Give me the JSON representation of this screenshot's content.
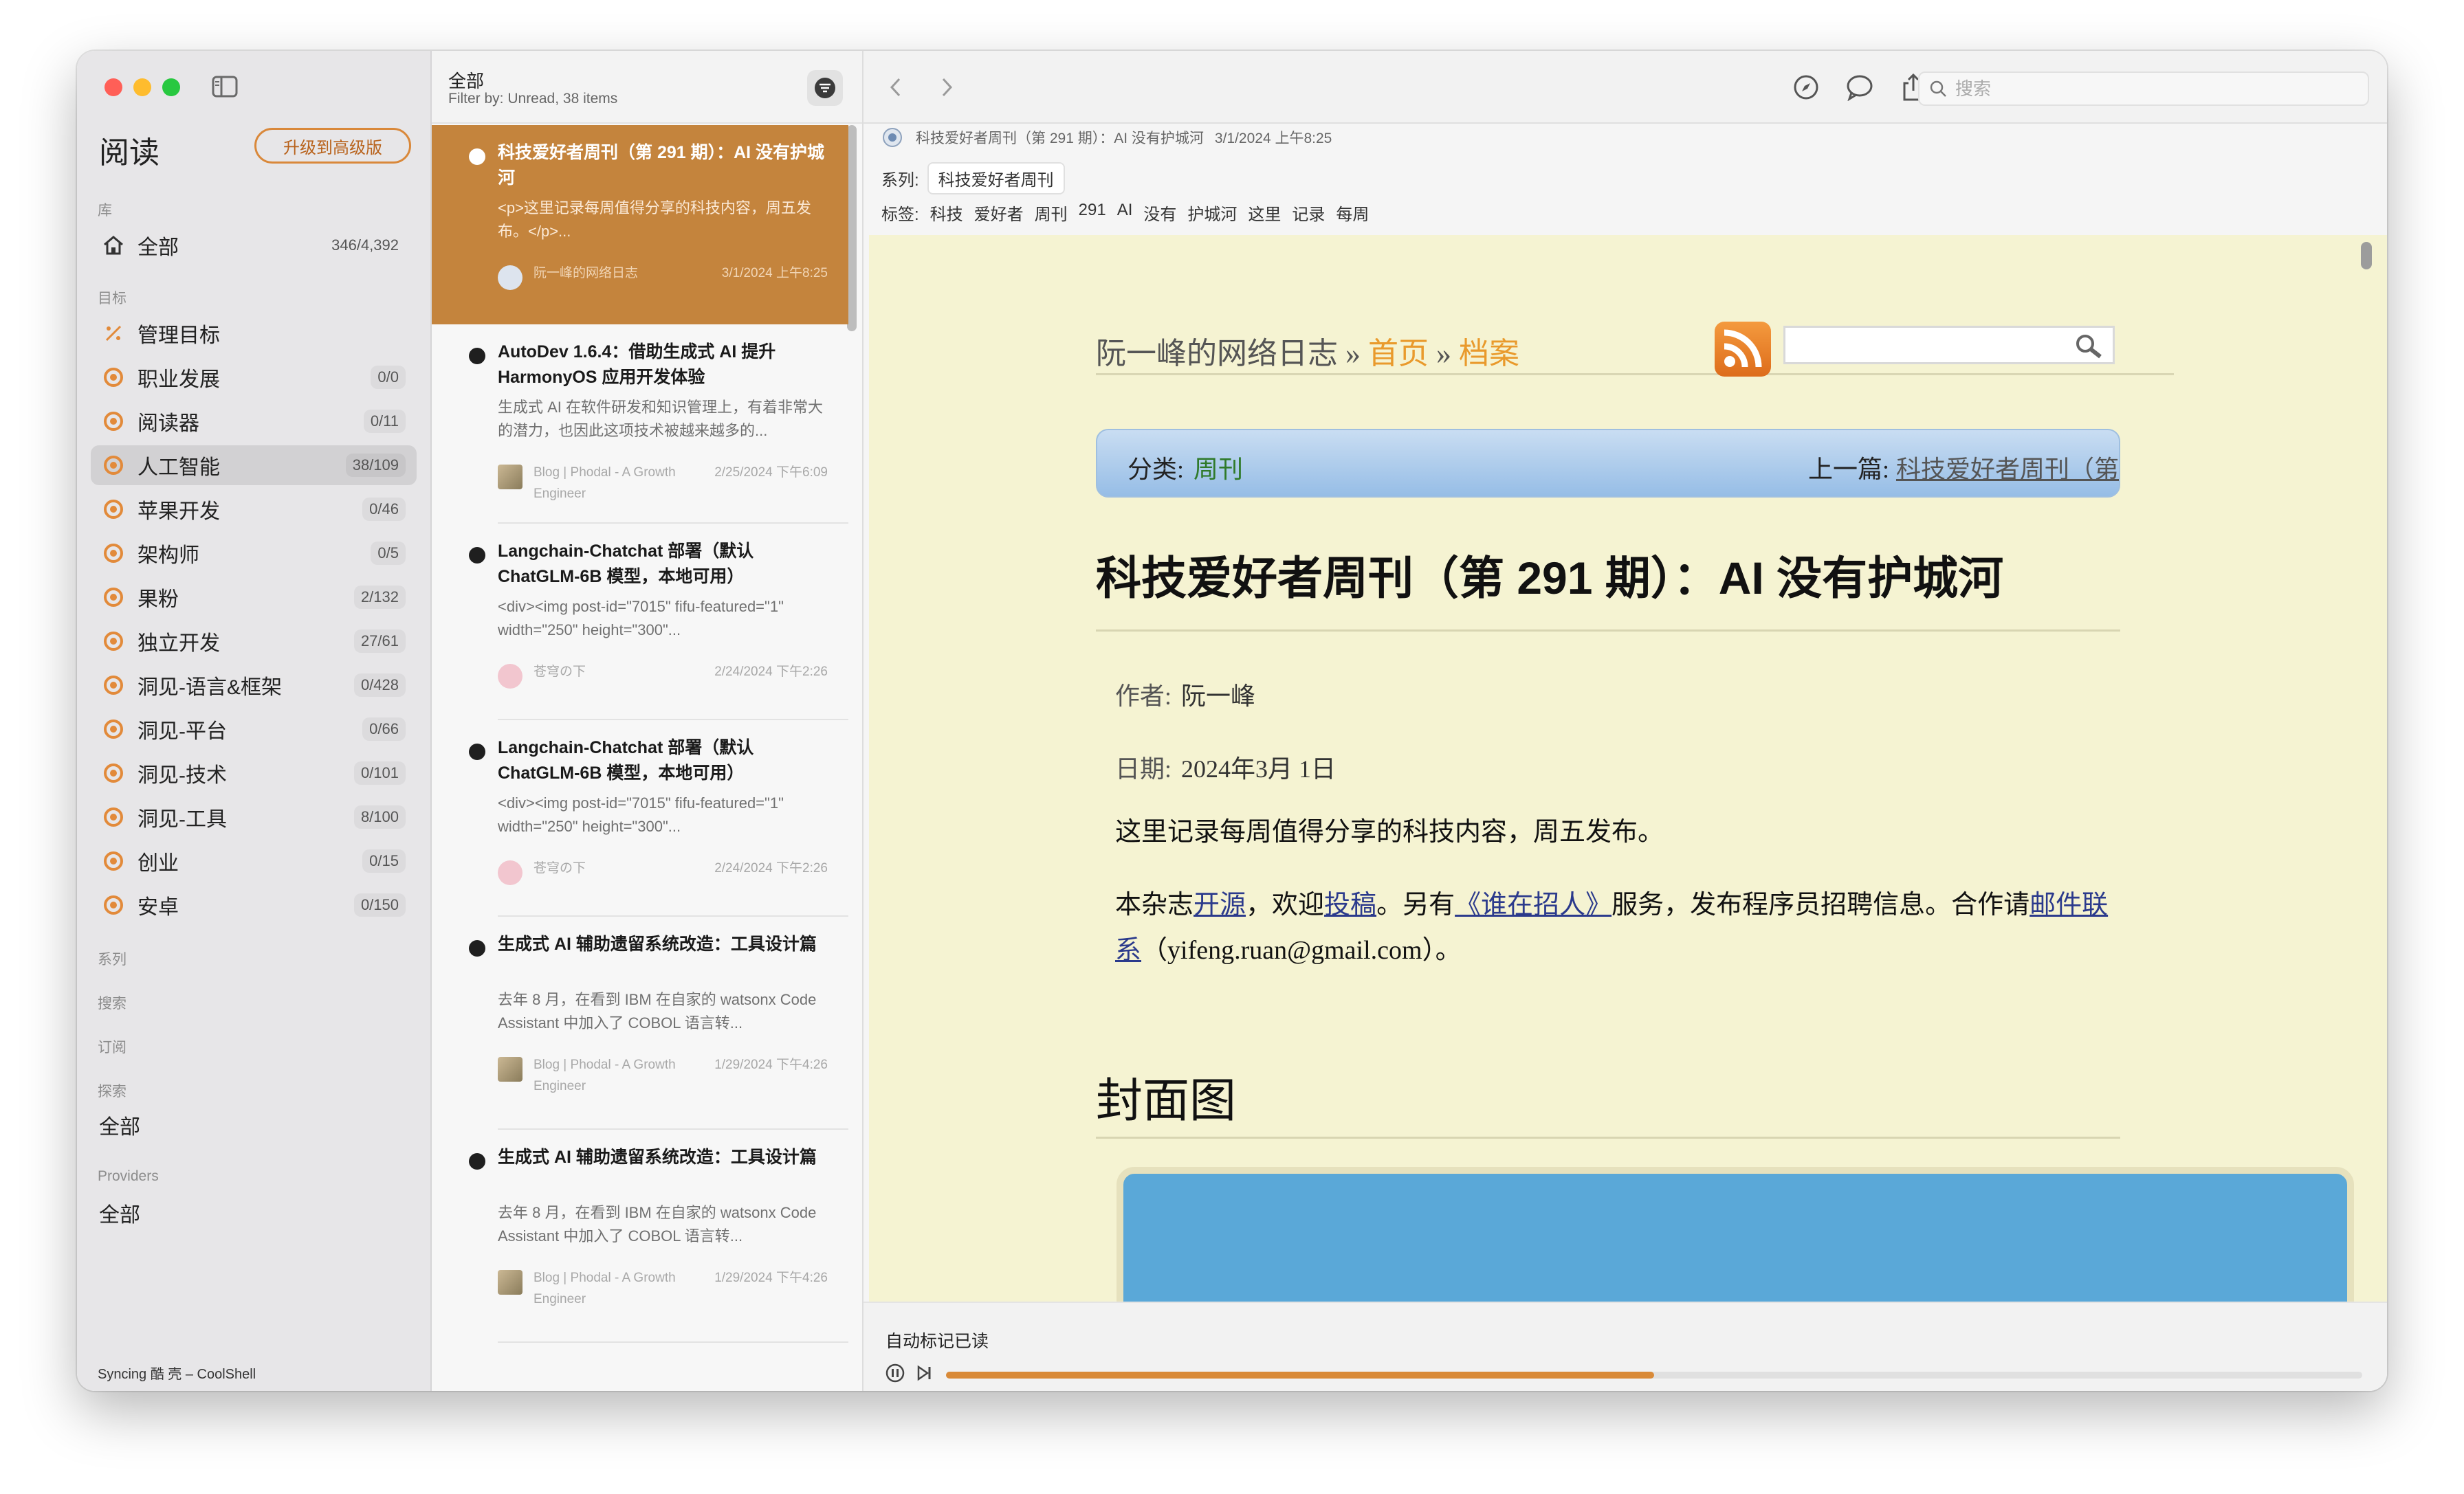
{
  "sidebar": {
    "app_title": "阅读",
    "upgrade_label": "升级到高级版",
    "section_library": "库",
    "all_item": {
      "label": "全部",
      "count": "346/4,392"
    },
    "section_goals": "目标",
    "manage_goals": "管理目标",
    "goals": [
      {
        "label": "职业发展",
        "count": "0/0"
      },
      {
        "label": "阅读器",
        "count": "0/11"
      },
      {
        "label": "人工智能",
        "count": "38/109",
        "selected": true
      },
      {
        "label": "苹果开发",
        "count": "0/46"
      },
      {
        "label": "架构师",
        "count": "0/5"
      },
      {
        "label": "果粉",
        "count": "2/132"
      },
      {
        "label": "独立开发",
        "count": "27/61"
      },
      {
        "label": "洞见-语言&框架",
        "count": "0/428"
      },
      {
        "label": "洞见-平台",
        "count": "0/66"
      },
      {
        "label": "洞见-技术",
        "count": "0/101"
      },
      {
        "label": "洞见-工具",
        "count": "8/100"
      },
      {
        "label": "创业",
        "count": "0/15"
      },
      {
        "label": "安卓",
        "count": "0/150"
      }
    ],
    "section_series": "系列",
    "section_search": "搜索",
    "section_subscriptions": "订阅",
    "section_explore": "探索",
    "explore_all": "全部",
    "section_providers": "Providers",
    "providers_all": "全部",
    "sync_status": "Syncing 酷 壳 – CoolShell"
  },
  "list": {
    "title": "全部",
    "filter": "Filter by: Unread, 38 items",
    "items": [
      {
        "title": "科技爱好者周刊（第 291 期）：AI 没有护城河",
        "snippet": "<p>这里记录每周值得分享的科技内容，周五发布。</p>...",
        "feed": "阮一峰的网络日志",
        "date": "3/1/2024 上午8:25"
      },
      {
        "title": "AutoDev 1.6.4：借助生成式 AI 提升 HarmonyOS 应用开发体验",
        "snippet": "生成式 AI 在软件研发和知识管理上，有着非常大的潜力，也因此这项技术被越来越多的...",
        "feed": "Blog | Phodal - A Growth Engineer",
        "date": "2/25/2024 下午6:09"
      },
      {
        "title": "Langchain-Chatchat 部署（默认 ChatGLM-6B 模型，本地可用）",
        "snippet": "<div><img post-id=\"7015\" fifu-featured=\"1\" width=\"250\" height=\"300\"...",
        "feed": "苍穹の下",
        "date": "2/24/2024 下午2:26"
      },
      {
        "title": "Langchain-Chatchat 部署（默认 ChatGLM-6B 模型，本地可用）",
        "snippet": "<div><img post-id=\"7015\" fifu-featured=\"1\" width=\"250\" height=\"300\"...",
        "feed": "苍穹の下",
        "date": "2/24/2024 下午2:26"
      },
      {
        "title": "生成式 AI 辅助遗留系统改造：工具设计篇",
        "snippet": "去年 8 月，在看到 IBM 在自家的 watsonx Code Assistant 中加入了 COBOL 语言转...",
        "feed": "Blog | Phodal - A Growth Engineer",
        "date": "1/29/2024 下午4:26"
      },
      {
        "title": "生成式 AI 辅助遗留系统改造：工具设计篇",
        "snippet": "去年 8 月，在看到 IBM 在自家的 watsonx Code Assistant 中加入了 COBOL 语言转...",
        "feed": "Blog | Phodal - A Growth Engineer",
        "date": "1/29/2024 下午4:26"
      }
    ]
  },
  "toolbar": {
    "search_placeholder": "搜索"
  },
  "article": {
    "meta_title": "科技爱好者周刊（第 291 期）：AI 没有护城河",
    "meta_date": "3/1/2024 上午8:25",
    "series_label": "系列:",
    "series_value": "科技爱好者周刊",
    "tags_label": "标签:",
    "tags": [
      "科技",
      "爱好者",
      "周刊",
      "291",
      "AI",
      "没有",
      "护城河",
      "这里",
      "记录",
      "每周"
    ],
    "blog_name": "阮一峰的网络日志",
    "crumb_sep": "»",
    "crumb_home": "首页",
    "crumb_archive": "档案",
    "category_label": "分类:",
    "category_value": "周刊",
    "prev_label": "上一篇:",
    "prev_value": "科技爱好者周刊（第",
    "title": "科技爱好者周刊（第 291 期）：AI 没有护城河",
    "author_label": "作者:",
    "author": "阮一峰",
    "date_label": "日期:",
    "date": "2024年3月 1日",
    "intro": "这里记录每周值得分享的科技内容，周五发布。",
    "p2": {
      "t1": "本杂志",
      "l1": "开源",
      "t2": "，欢迎",
      "l2": "投稿",
      "t3": "。另有",
      "l3": "《谁在招人》",
      "t4": "服务，发布程序员招聘信息。合作请",
      "l4": "邮件联系",
      "t5": "（yifeng.ruan@gmail.com）。"
    },
    "cover_heading": "封面图"
  },
  "bottom": {
    "auto_mark_read": "自动标记已读",
    "progress": 0.5
  },
  "colors": {
    "accent": "#c4843d",
    "goal_icon": "#e28a3a",
    "progress": "#d98a38",
    "page_bg": "#f5f3d2"
  }
}
